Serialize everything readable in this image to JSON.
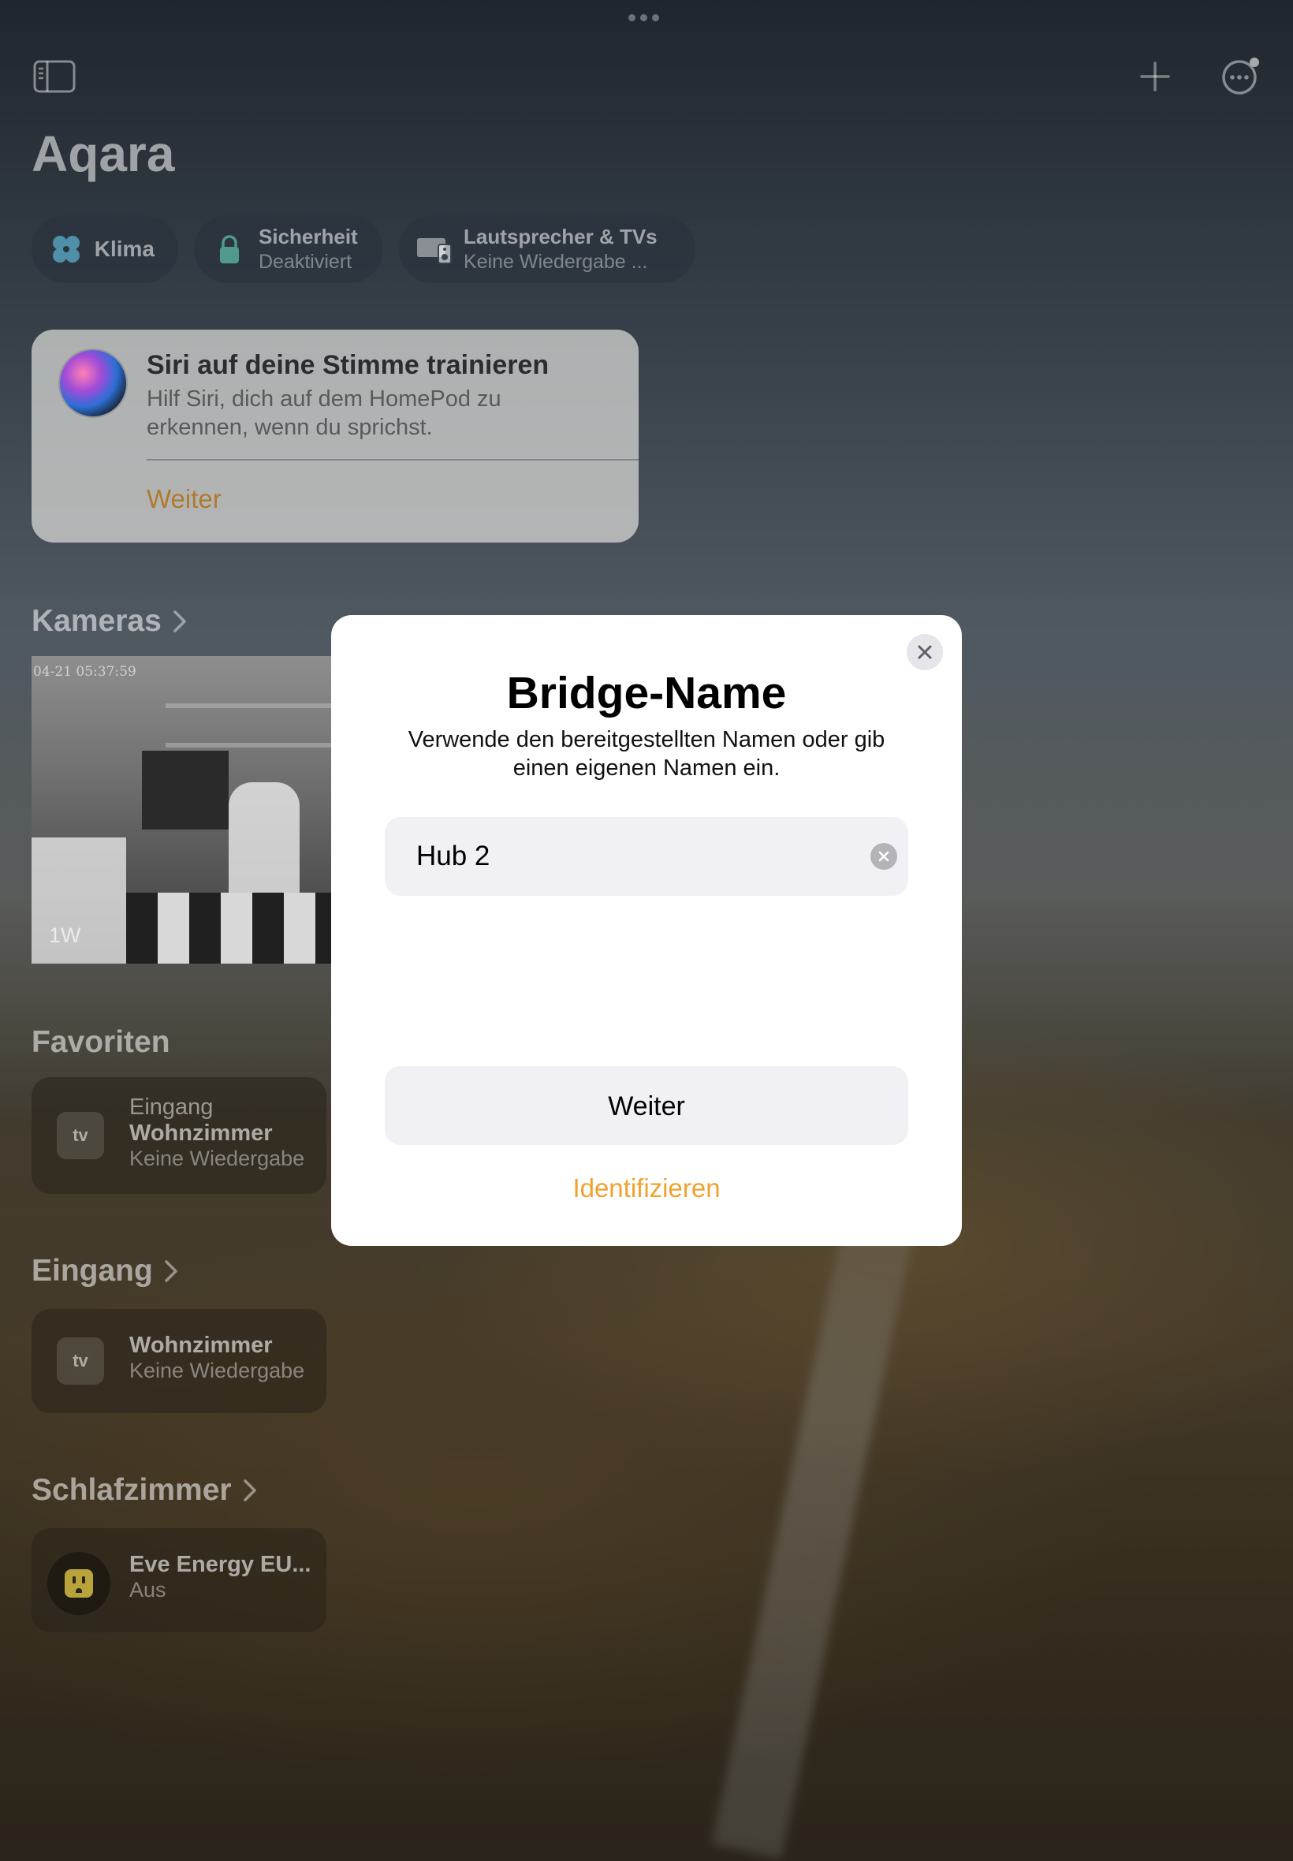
{
  "window": {
    "grabber": "more-dots"
  },
  "toolbar": {
    "sidebar_icon": "sidebar-icon",
    "add_icon": "plus-icon",
    "more_icon": "ellipsis-circle-icon"
  },
  "home": {
    "title": "Aqara"
  },
  "chips": [
    {
      "icon": "fan-icon",
      "title": "Klima",
      "subtitle": ""
    },
    {
      "icon": "lock-icon",
      "title": "Sicherheit",
      "subtitle": "Deaktiviert"
    },
    {
      "icon": "speaker-tv-icon",
      "title": "Lautsprecher & TVs",
      "subtitle": "Keine Wiedergabe ..."
    }
  ],
  "siri_card": {
    "title": "Siri auf deine Stimme trainieren",
    "description": "Hilf Siri, dich auf dem HomePod zu erkennen, wenn du sprichst.",
    "action": "Weiter"
  },
  "sections": {
    "cameras": "Kameras",
    "favorites": "Favoriten",
    "entrance": "Eingang",
    "bedroom": "Schlafzimmer"
  },
  "camera": {
    "timestamp": "04-21 05:37:59",
    "label": "1W"
  },
  "favorites_tile": {
    "icon_text": "tv",
    "room": "Eingang",
    "name": "Wohnzimmer",
    "status": "Keine Wiedergabe"
  },
  "entrance_tile": {
    "icon_text": "tv",
    "name": "Wohnzimmer",
    "status": "Keine Wiedergabe"
  },
  "bedroom_tile": {
    "icon": "outlet-icon",
    "name": "Eve Energy EU...",
    "status": "Aus"
  },
  "dialog": {
    "title": "Bridge-Name",
    "subtitle": "Verwende den bereitgestellten Namen oder gib einen eigenen Namen ein.",
    "name_value": "Hub 2",
    "primary_button": "Weiter",
    "secondary_button": "Identifizieren",
    "accent_color": "#f0a22e"
  }
}
